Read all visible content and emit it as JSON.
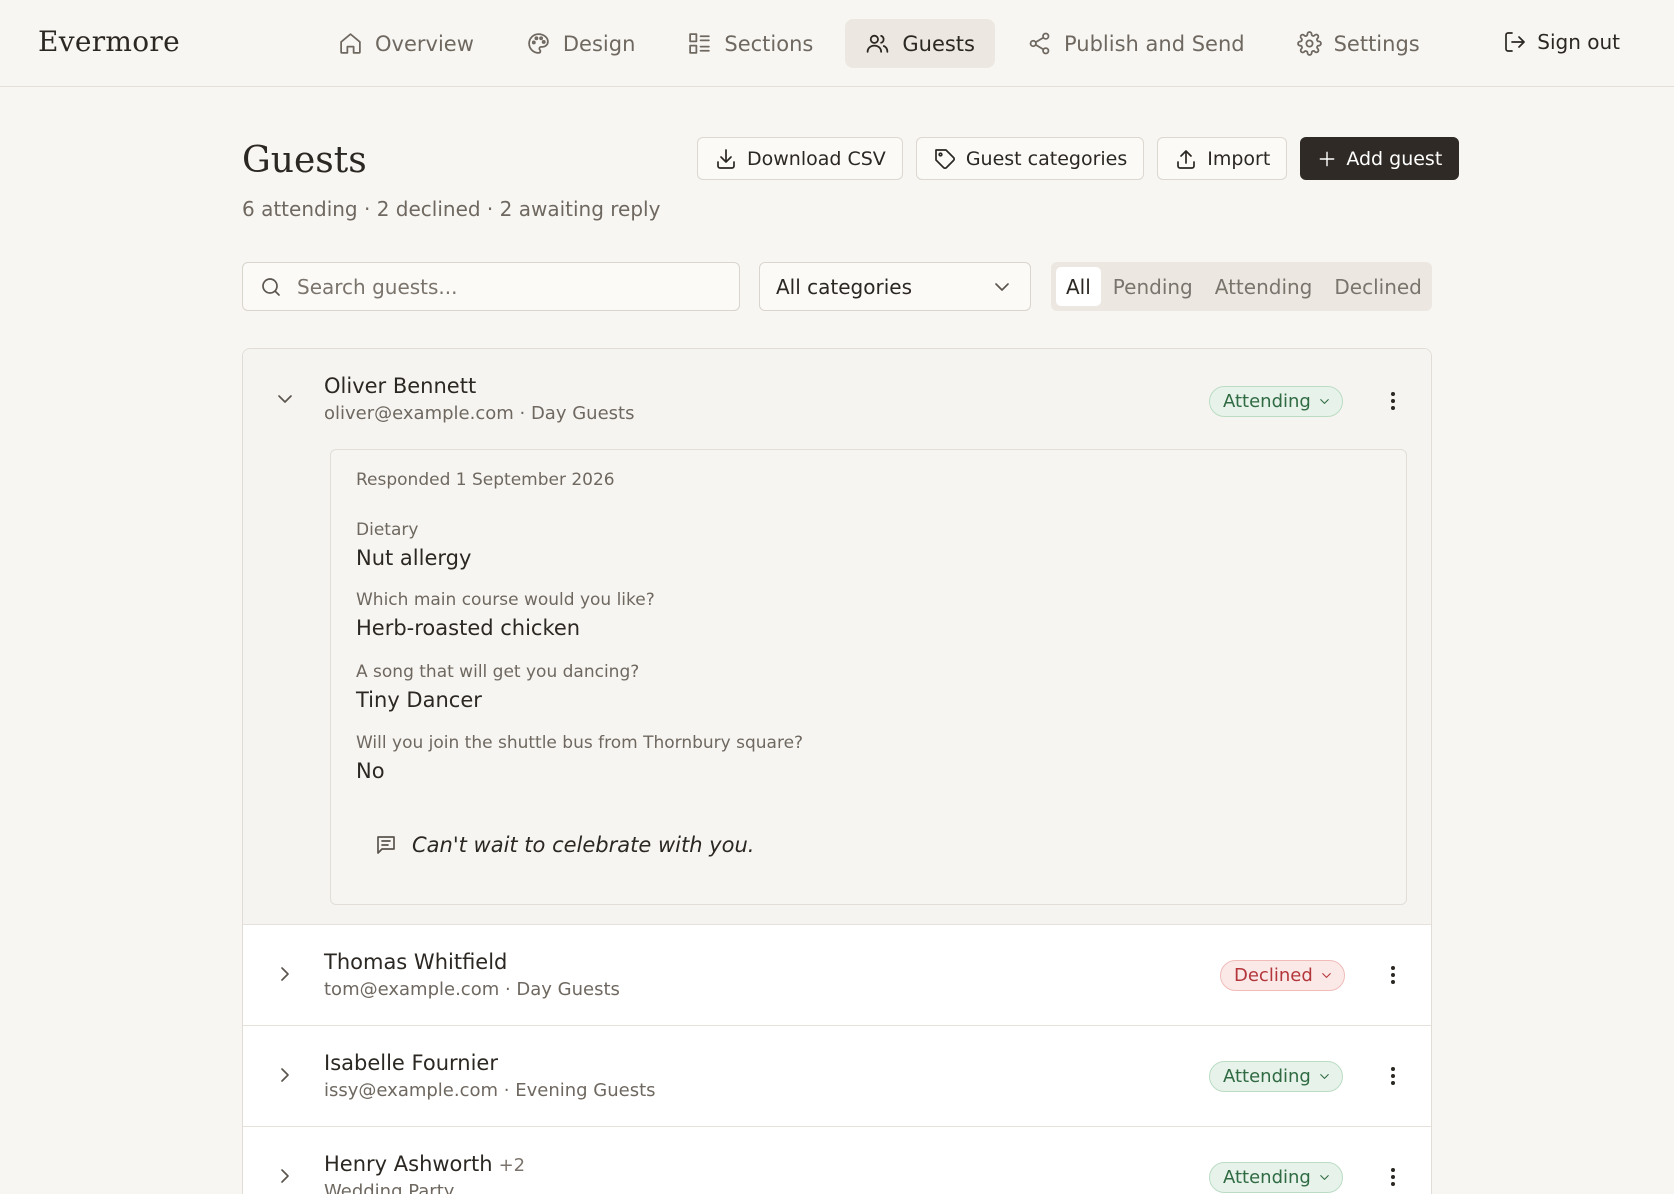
{
  "app": {
    "brand": "Evermore"
  },
  "nav": {
    "items": [
      {
        "label": "Overview",
        "icon": "home-icon"
      },
      {
        "label": "Design",
        "icon": "palette-icon"
      },
      {
        "label": "Sections",
        "icon": "sections-icon"
      },
      {
        "label": "Guests",
        "icon": "users-icon",
        "active": true
      },
      {
        "label": "Publish and Send",
        "icon": "share-icon"
      },
      {
        "label": "Settings",
        "icon": "gear-icon"
      }
    ],
    "sign_out": "Sign out"
  },
  "header": {
    "title": "Guests",
    "summary": "6 attending · 2 declined · 2 awaiting reply",
    "actions": {
      "download_csv": "Download CSV",
      "guest_categories": "Guest categories",
      "import": "Import",
      "add_guest": "Add guest"
    }
  },
  "filters": {
    "search_placeholder": "Search guests...",
    "category": "All categories",
    "status_tabs": [
      "All",
      "Pending",
      "Attending",
      "Declined"
    ],
    "active_status": "All"
  },
  "colors": {
    "attending_bg": "#e7f3ea",
    "attending_text": "#2f6a42",
    "declined_bg": "#fbe9e8",
    "declined_text": "#b3363a",
    "primary_button": "#2f2a25"
  },
  "guests": [
    {
      "name": "Oliver Bennett",
      "sub": "oliver@example.com · Day Guests",
      "status": "Attending",
      "expanded": true,
      "responded": "Responded 1 September 2026",
      "answers": [
        {
          "q": "Dietary",
          "a": "Nut allergy"
        },
        {
          "q": "Which main course would you like?",
          "a": "Herb-roasted chicken"
        },
        {
          "q": "A song that will get you dancing?",
          "a": "Tiny Dancer"
        },
        {
          "q": "Will you join the shuttle bus from Thornbury square?",
          "a": "No"
        }
      ],
      "message": "Can't wait to celebrate with you."
    },
    {
      "name": "Thomas Whitfield",
      "sub": "tom@example.com · Day Guests",
      "status": "Declined"
    },
    {
      "name": "Isabelle Fournier",
      "sub": "issy@example.com · Evening Guests",
      "status": "Attending"
    },
    {
      "name": "Henry Ashworth",
      "plus": "+2",
      "sub": "Wedding Party",
      "status": "Attending"
    }
  ]
}
